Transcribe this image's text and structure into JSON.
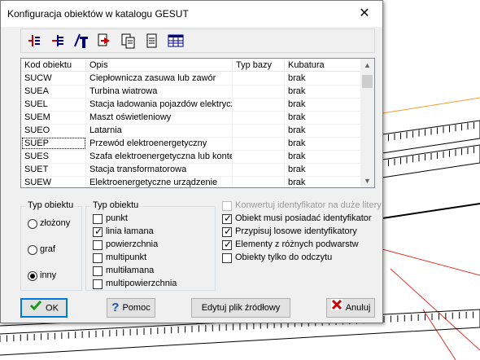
{
  "window": {
    "title": "Konfiguracja obiektów w katalogu GESUT",
    "close_glyph": "✕"
  },
  "toolbar": {
    "buttons": [
      {
        "icon": "insert-row-icon"
      },
      {
        "icon": "delete-row-icon"
      },
      {
        "icon": "text-format-icon"
      },
      {
        "icon": "export-icon"
      },
      {
        "icon": "copy-icon"
      },
      {
        "icon": "document-icon"
      },
      {
        "icon": "table-icon"
      }
    ]
  },
  "grid": {
    "columns": [
      "Kod obiektu",
      "Opis",
      "Typ bazy",
      "Kubatura"
    ],
    "rows": [
      [
        "SUCW",
        "Ciepłownicza zasuwa lub zawór",
        "",
        "brak"
      ],
      [
        "SUEA",
        "Turbina wiatrowa",
        "",
        "brak"
      ],
      [
        "SUEL",
        "Stacja ładowania pojazdów elektrycznych",
        "",
        "brak"
      ],
      [
        "SUEM",
        "Maszt oświetleniowy",
        "",
        "brak"
      ],
      [
        "SUEO",
        "Latarnia",
        "",
        "brak"
      ],
      [
        "SUEP",
        "Przewód elektroenergetyczny",
        "",
        "brak"
      ],
      [
        "SUES",
        "Szafa elektroenergetyczna lub kontener",
        "",
        "brak"
      ],
      [
        "SUET",
        "Stacja transformatorowa",
        "",
        "brak"
      ],
      [
        "SUEW",
        "Elektroenergetyczne urządzenie",
        "",
        "brak"
      ]
    ],
    "selected_row": 5
  },
  "typ_obiektu_radio": {
    "title": "Typ obiektu",
    "options": [
      "złożony",
      "graf",
      "inny"
    ],
    "selected": 2
  },
  "typ_obiektu_checks": {
    "title": "Typ obiektu",
    "options": [
      {
        "label": "punkt",
        "checked": false
      },
      {
        "label": "linia łamana",
        "checked": true
      },
      {
        "label": "powierzchnia",
        "checked": false
      },
      {
        "label": "multipunkt",
        "checked": false
      },
      {
        "label": "multiłamana",
        "checked": false
      },
      {
        "label": "multipowierzchnia",
        "checked": false
      }
    ]
  },
  "options": [
    {
      "label": "Konwertuj identyfikator na duże litery",
      "checked": false,
      "disabled": true
    },
    {
      "label": "Obiekt musi posiadać identyfikator",
      "checked": true,
      "disabled": false
    },
    {
      "label": "Przypisuj losowe identyfikatory",
      "checked": true,
      "disabled": false
    },
    {
      "label": "Elementy z różnych podwarstw",
      "checked": true,
      "disabled": false
    },
    {
      "label": "Obiekty tylko do odczytu",
      "checked": false,
      "disabled": false
    }
  ],
  "buttons": {
    "ok": "OK",
    "help": "Pomoc",
    "edit_source": "Edytuj plik źródłowy",
    "cancel": "Anuluj"
  },
  "colors": {
    "accent": "#0078d7",
    "map_red": "#e0332a",
    "map_orange": "#f0a030"
  }
}
